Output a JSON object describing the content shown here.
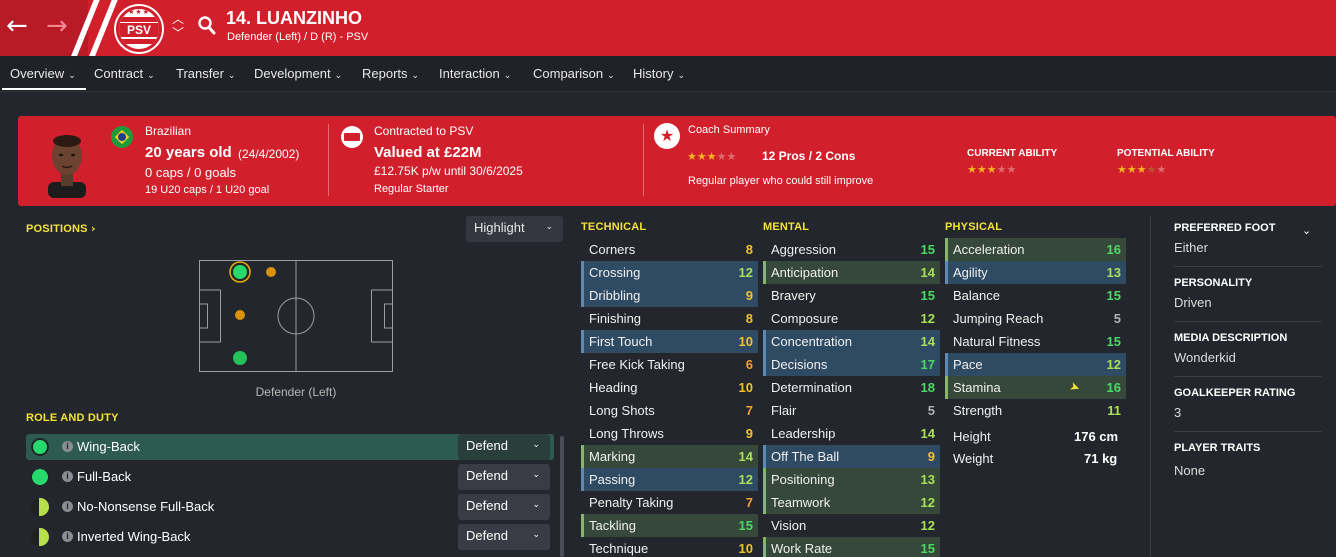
{
  "header": {
    "player_name": "14. LUANZINHO",
    "player_sub": "Defender (Left) / D (R) - PSV",
    "club_badge_text": "PSV"
  },
  "tabs": [
    {
      "label": "Overview"
    },
    {
      "label": "Contract"
    },
    {
      "label": "Transfer"
    },
    {
      "label": "Development"
    },
    {
      "label": "Reports"
    },
    {
      "label": "Interaction"
    },
    {
      "label": "Comparison"
    },
    {
      "label": "History"
    }
  ],
  "info": {
    "nationality": "Brazilian",
    "age": "20 years old",
    "dob": "(24/4/2002)",
    "caps": "0 caps / 0 goals",
    "u20": "19 U20 caps / 1 U20 goal",
    "contracted": "Contracted to PSV",
    "valued": "Valued at £22M",
    "wage": "£12.75K p/w until 30/6/2025",
    "status": "Regular Starter",
    "coach_title": "Coach Summary",
    "pros_cons": "12 Pros / 2 Cons",
    "coach_text": "Regular player who could still improve",
    "current_ability_label": "CURRENT ABILITY",
    "potential_ability_label": "POTENTIAL ABILITY",
    "coach_stars": 3,
    "current_ability_stars": 3,
    "potential_ability_stars": 3.5
  },
  "positions": {
    "heading": "POSITIONS",
    "highlight_label": "Highlight",
    "position_label": "Defender (Left)"
  },
  "roles": {
    "heading": "ROLE AND DUTY",
    "items": [
      {
        "name": "Wing-Back",
        "duty": "Defend"
      },
      {
        "name": "Full-Back",
        "duty": "Defend"
      },
      {
        "name": "No-Nonsense Full-Back",
        "duty": "Defend"
      },
      {
        "name": "Inverted Wing-Back",
        "duty": "Defend"
      }
    ]
  },
  "attributes": {
    "technical_heading": "TECHNICAL",
    "mental_heading": "MENTAL",
    "physical_heading": "PHYSICAL",
    "technical": [
      {
        "name": "Corners",
        "value": "8"
      },
      {
        "name": "Crossing",
        "value": "12"
      },
      {
        "name": "Dribbling",
        "value": "9"
      },
      {
        "name": "Finishing",
        "value": "8"
      },
      {
        "name": "First Touch",
        "value": "10"
      },
      {
        "name": "Free Kick Taking",
        "value": "6"
      },
      {
        "name": "Heading",
        "value": "10"
      },
      {
        "name": "Long Shots",
        "value": "7"
      },
      {
        "name": "Long Throws",
        "value": "9"
      },
      {
        "name": "Marking",
        "value": "14"
      },
      {
        "name": "Passing",
        "value": "12"
      },
      {
        "name": "Penalty Taking",
        "value": "7"
      },
      {
        "name": "Tackling",
        "value": "15"
      },
      {
        "name": "Technique",
        "value": "10"
      }
    ],
    "mental": [
      {
        "name": "Aggression",
        "value": "15"
      },
      {
        "name": "Anticipation",
        "value": "14"
      },
      {
        "name": "Bravery",
        "value": "15"
      },
      {
        "name": "Composure",
        "value": "12"
      },
      {
        "name": "Concentration",
        "value": "14"
      },
      {
        "name": "Decisions",
        "value": "17"
      },
      {
        "name": "Determination",
        "value": "18"
      },
      {
        "name": "Flair",
        "value": "5"
      },
      {
        "name": "Leadership",
        "value": "14"
      },
      {
        "name": "Off The Ball",
        "value": "9"
      },
      {
        "name": "Positioning",
        "value": "13"
      },
      {
        "name": "Teamwork",
        "value": "12"
      },
      {
        "name": "Vision",
        "value": "12"
      },
      {
        "name": "Work Rate",
        "value": "15"
      }
    ],
    "physical": [
      {
        "name": "Acceleration",
        "value": "16"
      },
      {
        "name": "Agility",
        "value": "13"
      },
      {
        "name": "Balance",
        "value": "15"
      },
      {
        "name": "Jumping Reach",
        "value": "5"
      },
      {
        "name": "Natural Fitness",
        "value": "15"
      },
      {
        "name": "Pace",
        "value": "12"
      },
      {
        "name": "Stamina",
        "value": "16"
      },
      {
        "name": "Strength",
        "value": "11"
      }
    ],
    "height_label": "Height",
    "height_value": "176 cm",
    "weight_label": "Weight",
    "weight_value": "71 kg"
  },
  "side": {
    "preferred_foot_label": "PREFERRED FOOT",
    "preferred_foot": "Either",
    "personality_label": "PERSONALITY",
    "personality": "Driven",
    "media_label": "MEDIA DESCRIPTION",
    "media": "Wonderkid",
    "gk_label": "GOALKEEPER RATING",
    "gk": "3",
    "traits_label": "PLAYER TRAITS",
    "traits": "None"
  },
  "colors": {
    "club_red": "#d11f2c",
    "section_yellow": "#f2e33a",
    "value_green": "#4cd964",
    "value_lime": "#a8e05a",
    "value_yellow": "#f1c232",
    "value_orange": "#f0a030",
    "value_grey": "#b0b0b0"
  }
}
